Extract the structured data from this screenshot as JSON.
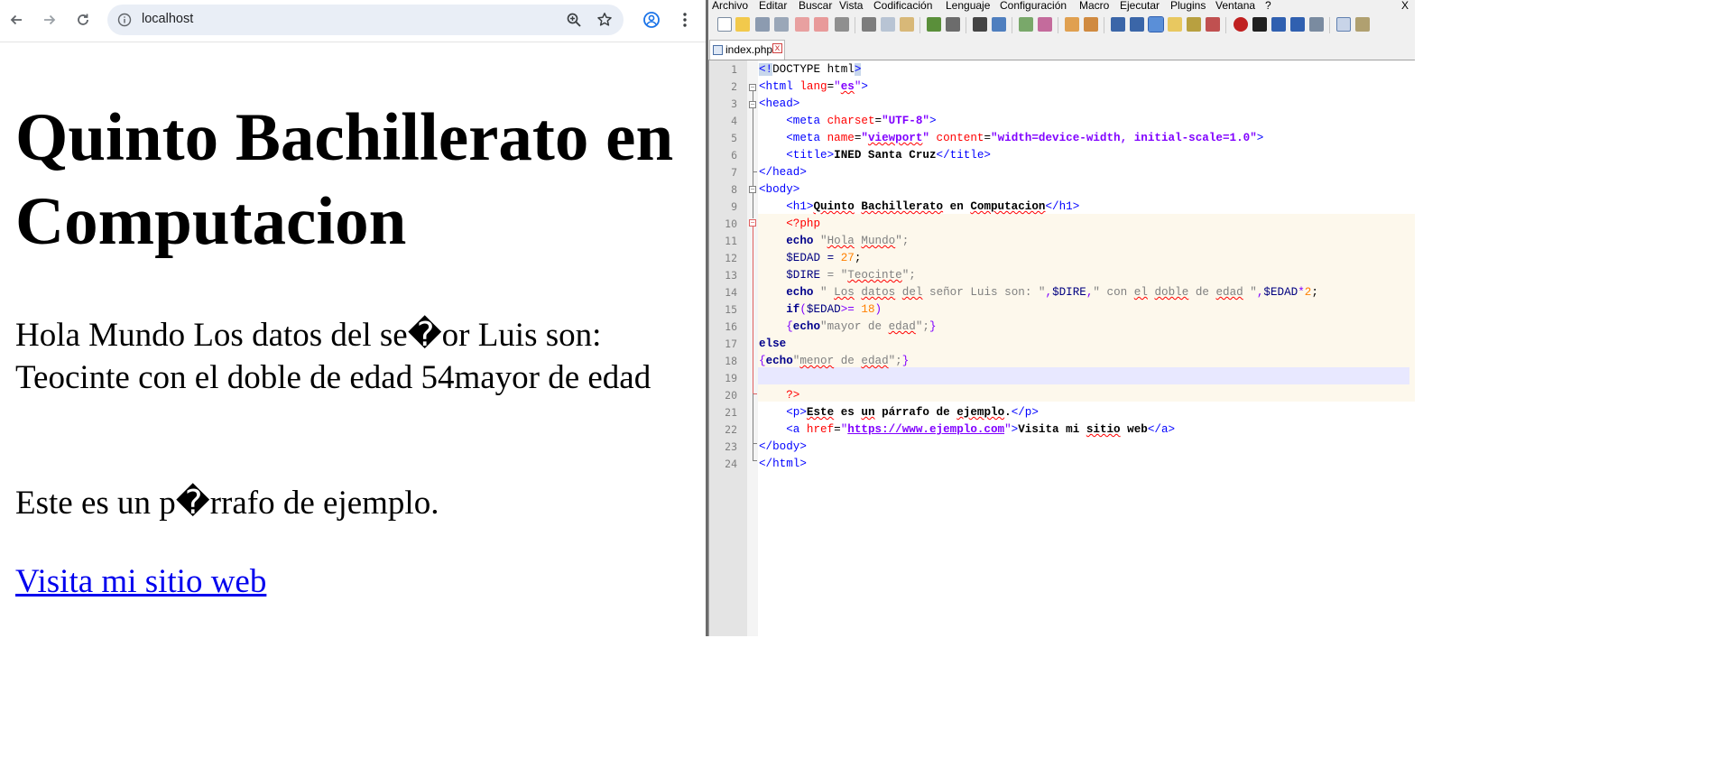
{
  "browser": {
    "url": "localhost",
    "page": {
      "h1": "Quinto Bachillerato en Computacion",
      "output": "Hola Mundo Los datos del se�or Luis son: Teocinte con el doble de edad 54mayor de edad",
      "paragraph": "Este es un p�rrafo de ejemplo.",
      "link": "Visita mi sitio web"
    },
    "icons": [
      "back-icon",
      "forward-icon",
      "reload-icon",
      "site-info-icon",
      "zoom-icon",
      "bookmark-star-icon",
      "profile-icon",
      "kebab-menu-icon"
    ]
  },
  "editor": {
    "menu": [
      "Archivo",
      "Editar",
      "Buscar",
      "Vista",
      "Codificación",
      "Lenguaje",
      "Configuración",
      "Macro",
      "Ejecutar",
      "Plugins",
      "Ventana",
      "?"
    ],
    "close_label": "X",
    "tab": {
      "label": "index.php",
      "close": "x"
    },
    "line_numbers": [
      "1",
      "2",
      "3",
      "4",
      "5",
      "6",
      "7",
      "8",
      "9",
      "10",
      "11",
      "12",
      "13",
      "14",
      "15",
      "16",
      "17",
      "18",
      "19",
      "20",
      "21",
      "22",
      "23",
      "24"
    ],
    "tokens": {
      "l1": [
        "<!",
        "DOCTYPE html",
        ">"
      ],
      "l2": [
        "<html ",
        "lang",
        "=",
        "\"",
        "es",
        "\"",
        ">"
      ],
      "l3": [
        "<head>"
      ],
      "l4": [
        "    ",
        "<meta ",
        "charset",
        "=",
        "\"UTF-8\"",
        ">"
      ],
      "l5": [
        "    ",
        "<meta ",
        "name",
        "=",
        "\"",
        "viewport",
        "\"",
        " content",
        "=",
        "\"width=device-width, initial-scale=1.0\"",
        ">"
      ],
      "l6": [
        "    ",
        "<title>",
        "INED Santa Cruz",
        "</title>"
      ],
      "l7": [
        "</head>"
      ],
      "l8": [
        "<body>"
      ],
      "l9": [
        "    ",
        "<h1>",
        "Quinto",
        " ",
        "Bachillerato",
        " en ",
        "Computacion",
        "</h1>"
      ],
      "l10": [
        "    ",
        "<?php"
      ],
      "l11": [
        "    ",
        "echo",
        " \"",
        "Hola",
        " ",
        "Mundo",
        "\";"
      ],
      "l12": [
        "    ",
        "$EDAD",
        " = ",
        "27",
        ";"
      ],
      "l13": [
        "    ",
        "$DIRE",
        " = \"",
        "Teocinte",
        "\";"
      ],
      "l14": [
        "    ",
        "echo",
        " \" ",
        "Los",
        " ",
        "datos",
        " ",
        "del",
        " señor Luis son: \"",
        ",",
        "$DIRE",
        ",",
        "\" con ",
        "el",
        " ",
        "doble",
        " de ",
        "edad",
        " \"",
        ",",
        "$EDAD",
        "*",
        "2",
        ";"
      ],
      "l15": [
        "    ",
        "if",
        "(",
        "$EDAD",
        ">=",
        " 18",
        ")"
      ],
      "l16": [
        "    ",
        "{",
        "echo",
        "\"mayor de ",
        "edad",
        "\";",
        "}"
      ],
      "l17": [
        "else"
      ],
      "l18": [
        "{",
        "echo",
        "\"",
        "menor",
        " de ",
        "edad",
        "\";",
        "}"
      ],
      "l19": [
        ""
      ],
      "l20": [
        "    ",
        "?>"
      ],
      "l21": [
        "    ",
        "<p>",
        "Este",
        " es ",
        "un",
        " ",
        "párrafo",
        " de ",
        "ejemplo",
        ".",
        "</p>"
      ],
      "l22": [
        "    ",
        "<a ",
        "href",
        "=",
        "\"",
        "https://www.ejemplo.com",
        "\"",
        ">",
        "Visita",
        " mi ",
        "sitio",
        " web",
        "</a>"
      ],
      "l23": [
        "</body>"
      ],
      "l24": [
        "</html>"
      ]
    }
  }
}
